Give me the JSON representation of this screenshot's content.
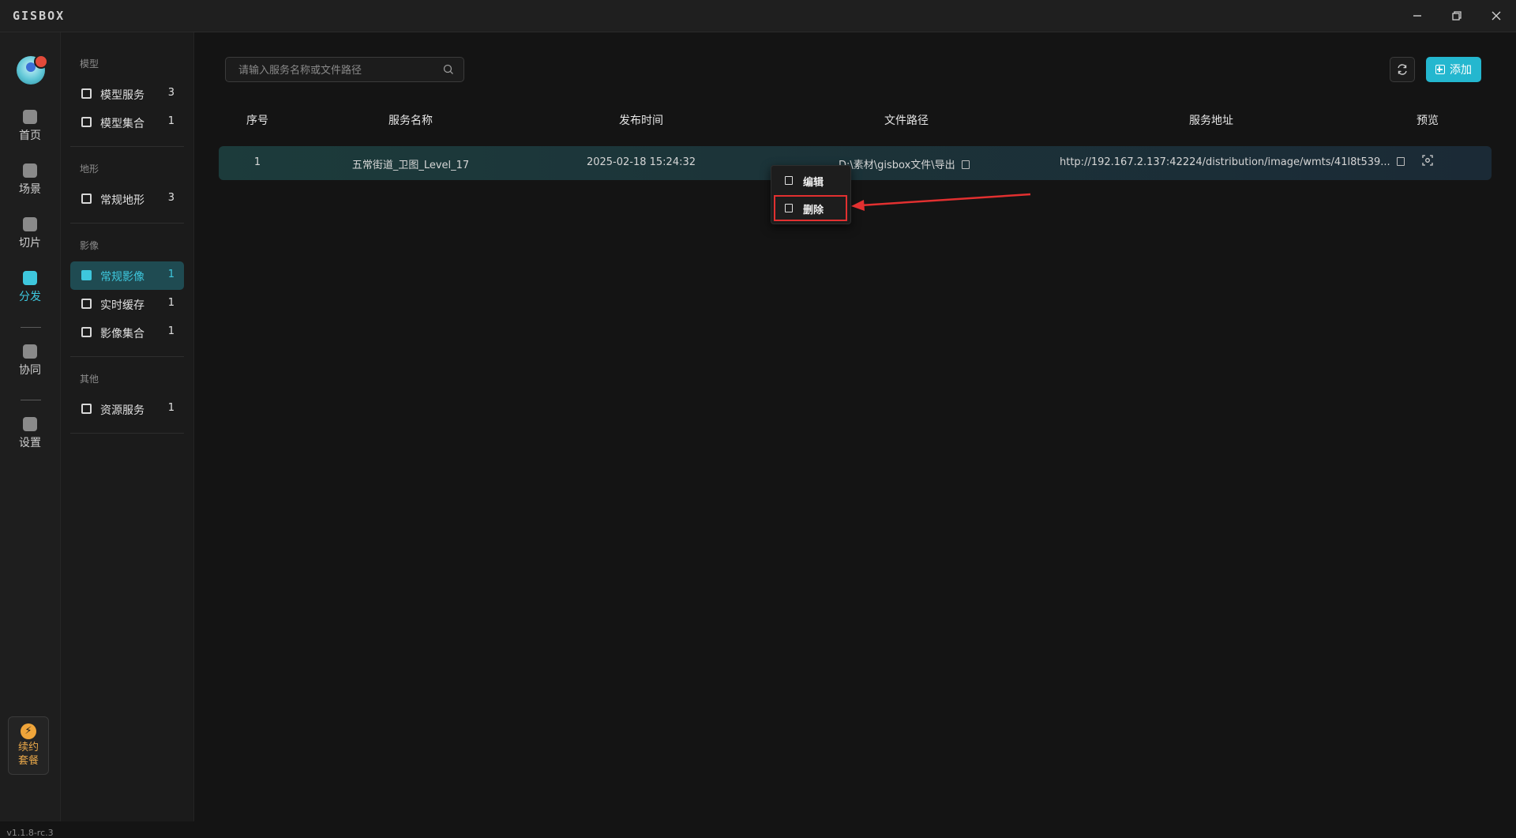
{
  "app": {
    "logo": "GISBOX"
  },
  "window_controls": {
    "minimize": "minimize-icon",
    "restore": "restore-icon",
    "close": "close-icon"
  },
  "rail": {
    "items": [
      {
        "label": "首页",
        "icon": "home-icon"
      },
      {
        "label": "场景",
        "icon": "scene-icon"
      },
      {
        "label": "切片",
        "icon": "tile-icon"
      },
      {
        "label": "分发",
        "icon": "distribute-icon",
        "active": true
      },
      {
        "label": "协同",
        "icon": "collab-icon"
      },
      {
        "label": "设置",
        "icon": "settings-icon"
      }
    ],
    "renew_line1": "续约",
    "renew_line2": "套餐",
    "version": "v1.1.8-rc.3"
  },
  "subnav": {
    "groups": [
      {
        "title": "模型",
        "items": [
          {
            "label": "模型服务",
            "count": "3"
          },
          {
            "label": "模型集合",
            "count": "1"
          }
        ]
      },
      {
        "title": "地形",
        "items": [
          {
            "label": "常规地形",
            "count": "3"
          }
        ]
      },
      {
        "title": "影像",
        "items": [
          {
            "label": "常规影像",
            "count": "1",
            "active": true
          },
          {
            "label": "实时缓存",
            "count": "1"
          },
          {
            "label": "影像集合",
            "count": "1"
          }
        ]
      },
      {
        "title": "其他",
        "items": [
          {
            "label": "资源服务",
            "count": "1"
          }
        ]
      }
    ]
  },
  "toolbar": {
    "search_placeholder": "请输入服务名称或文件路径",
    "add_label": "添加"
  },
  "table": {
    "headers": [
      "序号",
      "服务名称",
      "发布时间",
      "文件路径",
      "服务地址",
      "预览"
    ],
    "rows": [
      {
        "index": "1",
        "name": "五常街道_卫图_Level_17",
        "time": "2025-02-18 15:24:32",
        "path": "D:\\素材\\gisbox文件\\导出",
        "url": "http://192.167.2.137:42224/distribution/image/wmts/41l8t539..."
      }
    ]
  },
  "context_menu": {
    "edit": "编辑",
    "delete": "删除"
  },
  "colors": {
    "accent": "#3ec7dd",
    "add_button": "#24b7cf",
    "highlight": "#e23030"
  }
}
